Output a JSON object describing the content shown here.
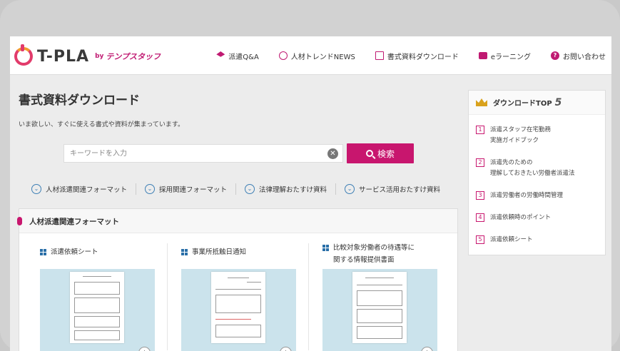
{
  "header": {
    "logo_text": "T-PLA",
    "logo_by": "by",
    "logo_brand": "テンプスタッフ",
    "nav": [
      {
        "label": "派遣Q&A",
        "icon": "graduation-cap-icon"
      },
      {
        "label": "人材トレンドNEWS",
        "icon": "check-circle-icon"
      },
      {
        "label": "書式資料ダウンロード",
        "icon": "document-download-icon"
      },
      {
        "label": "eラーニング",
        "icon": "books-icon"
      },
      {
        "label": "お問い合わせ",
        "icon": "question-icon",
        "glyph": "?"
      }
    ]
  },
  "main": {
    "title": "書式資料ダウンロード",
    "description": "いま欲しい、すぐに使える書式や資料が集まっています。",
    "search": {
      "placeholder": "キーワードを入力",
      "clear_glyph": "✕",
      "button_label": "検索"
    },
    "categories": [
      {
        "label": "人材派遣関連フォーマット",
        "glyph": "⌄"
      },
      {
        "label": "採用関連フォーマット",
        "glyph": "⌄"
      },
      {
        "label": "法律理解おたすけ資料",
        "glyph": "⌄"
      },
      {
        "label": "サービス活用おたすけ資料",
        "glyph": "⌄"
      }
    ],
    "section": {
      "title": "人材派遣関連フォーマット",
      "cards": [
        {
          "title_line1": "派遣依頼シート",
          "title_line2": ""
        },
        {
          "title_line1": "事業所抵触日通知",
          "title_line2": ""
        },
        {
          "title_line1": "比較対象労働者の待遇等に",
          "title_line2": "関する情報提供書面"
        }
      ],
      "zoom_glyph": "+"
    }
  },
  "sidebar": {
    "title": "ダウンロードTOP",
    "title_num": "5",
    "items": [
      {
        "rank": "1",
        "line1": "派遣スタッフ在宅勤務",
        "line2": "実施ガイドブック"
      },
      {
        "rank": "2",
        "line1": "派遣先のための",
        "line2": "理解しておきたい労働者派遣法"
      },
      {
        "rank": "3",
        "line1": "派遣労働者の労働時間管理",
        "line2": ""
      },
      {
        "rank": "4",
        "line1": "派遣依頼時のポイント",
        "line2": ""
      },
      {
        "rank": "5",
        "line1": "派遣依頼シート",
        "line2": ""
      }
    ]
  },
  "colors": {
    "accent": "#c8166e",
    "link_blue": "#3d7fb5",
    "thumb_bg": "#cbe3ec"
  }
}
